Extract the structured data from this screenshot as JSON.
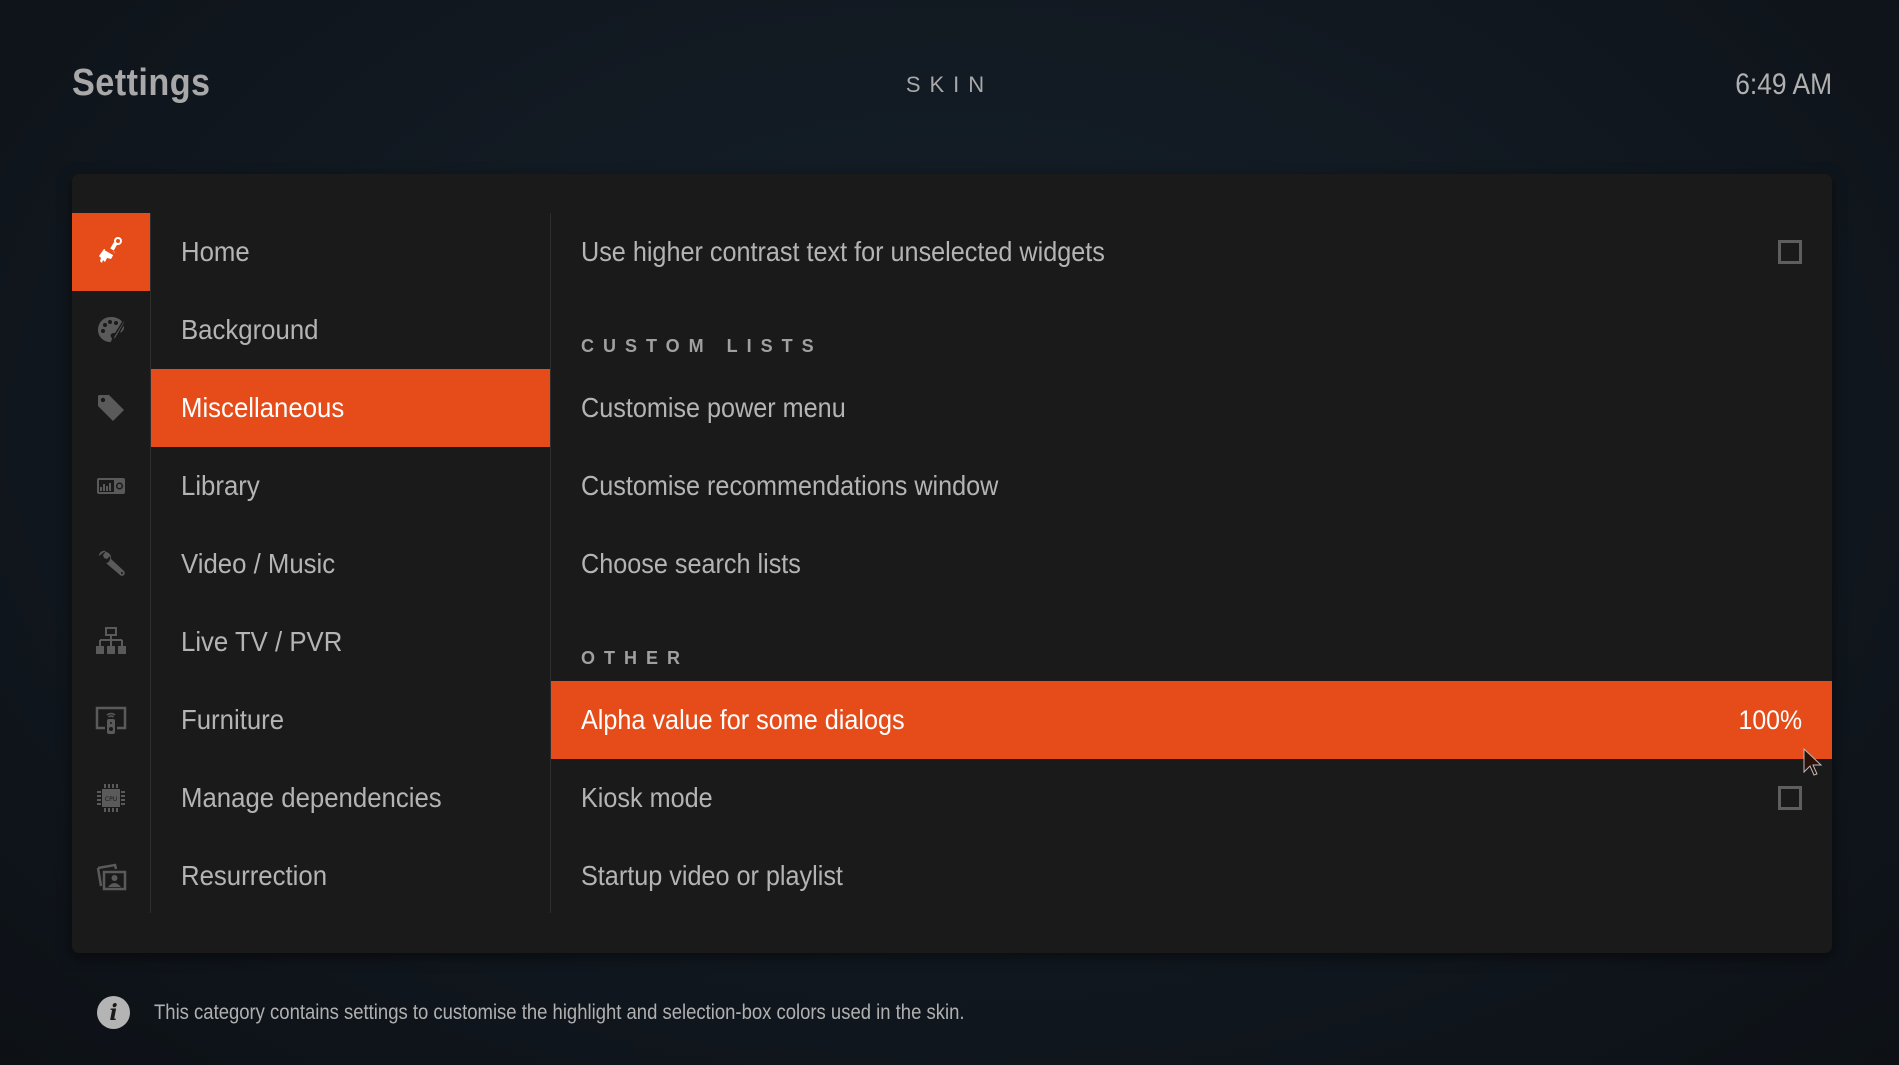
{
  "header": {
    "title": "Settings",
    "section": "SKIN",
    "clock": "6:49 AM"
  },
  "sidebar": {
    "icons": [
      {
        "name": "paintbrush-icon",
        "active": true
      },
      {
        "name": "palette-icon",
        "active": false
      },
      {
        "name": "tag-icon",
        "active": false
      },
      {
        "name": "equalizer-device-icon",
        "active": false
      },
      {
        "name": "wrench-icon",
        "active": false
      },
      {
        "name": "network-tree-icon",
        "active": false
      },
      {
        "name": "remote-control-icon",
        "active": false
      },
      {
        "name": "cpu-chip-icon",
        "active": false
      },
      {
        "name": "photo-portrait-icon",
        "active": false
      }
    ],
    "categories": [
      {
        "label": "Home",
        "active": false
      },
      {
        "label": "Background",
        "active": false
      },
      {
        "label": "Miscellaneous",
        "active": true
      },
      {
        "label": "Library",
        "active": false
      },
      {
        "label": "Video / Music",
        "active": false
      },
      {
        "label": "Live TV / PVR",
        "active": false
      },
      {
        "label": "Furniture",
        "active": false
      },
      {
        "label": "Manage dependencies",
        "active": false
      },
      {
        "label": "Resurrection",
        "active": false
      }
    ]
  },
  "content": {
    "items": [
      {
        "type": "toggle",
        "label": "Use higher contrast text for unselected widgets",
        "checked": false
      },
      {
        "type": "header",
        "label": "CUSTOM LISTS"
      },
      {
        "type": "action",
        "label": "Customise power menu"
      },
      {
        "type": "action",
        "label": "Customise recommendations window"
      },
      {
        "type": "action",
        "label": "Choose search lists"
      },
      {
        "type": "header",
        "label": "OTHER"
      },
      {
        "type": "value",
        "label": "Alpha value for some dialogs",
        "value": "100%",
        "active": true
      },
      {
        "type": "toggle",
        "label": "Kiosk mode",
        "checked": false
      },
      {
        "type": "action",
        "label": "Startup video or playlist"
      }
    ]
  },
  "footer": {
    "icon": "info-icon",
    "text": "This category contains settings to customise the highlight and selection-box colors used in the skin."
  },
  "colors": {
    "accent": "#e64c19",
    "panel": "#1a1a1a",
    "text": "#b4b4b4"
  }
}
